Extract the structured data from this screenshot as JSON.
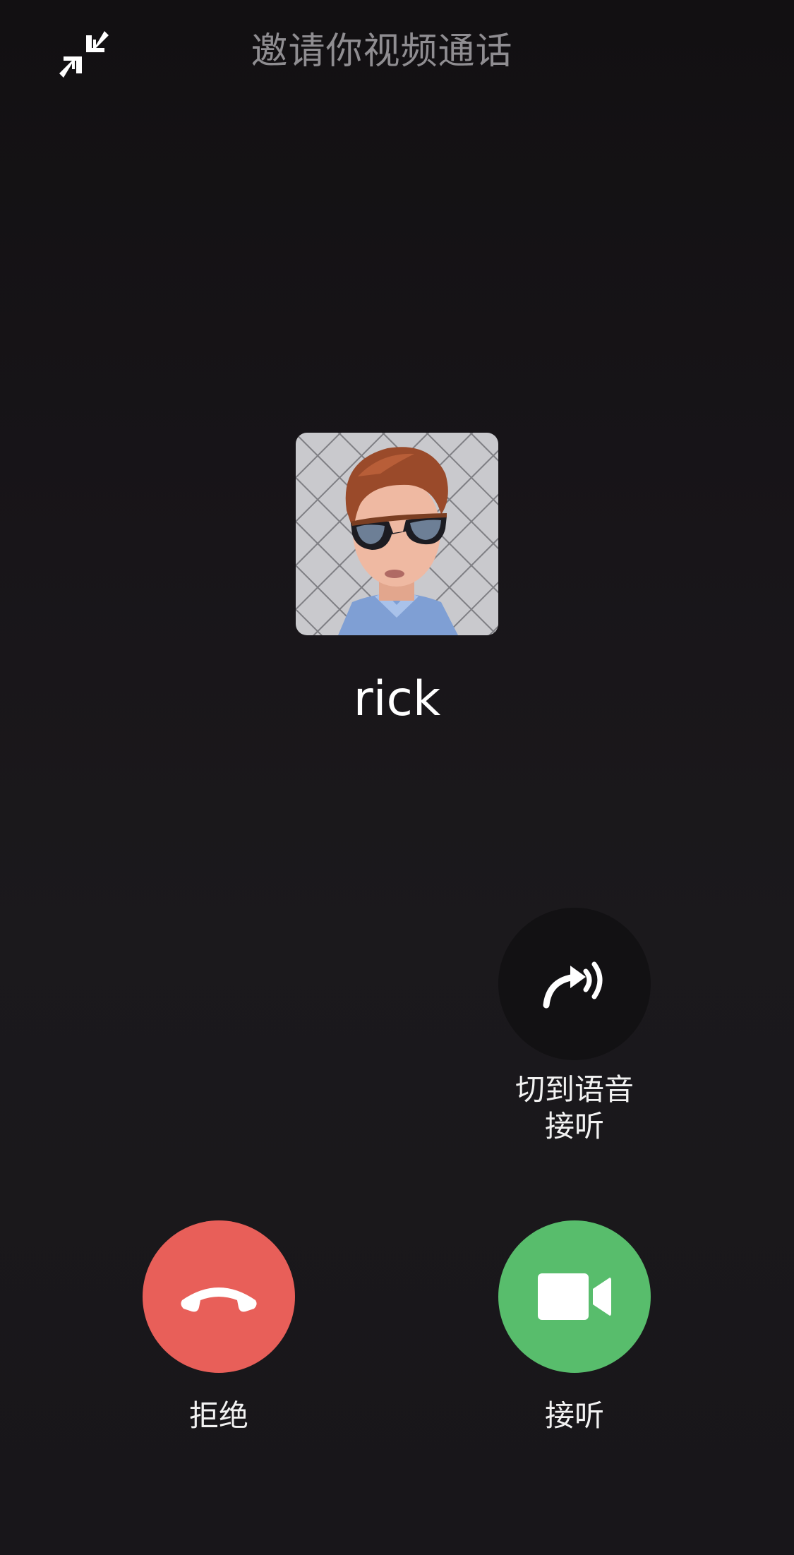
{
  "header": {
    "title": "邀请你视频通话",
    "minimize_icon": "minimize-arrows-icon"
  },
  "caller": {
    "name": "rick",
    "avatar": "caller-avatar-photo"
  },
  "actions": {
    "switch_voice": {
      "label_line1": "切到语音",
      "label_line2": "接听",
      "icon": "switch-to-voice-icon"
    },
    "decline": {
      "label": "拒绝",
      "icon": "hang-up-phone-icon",
      "color": "#e85f59"
    },
    "accept": {
      "label": "接听",
      "icon": "video-camera-icon",
      "color": "#58bd6c"
    }
  }
}
